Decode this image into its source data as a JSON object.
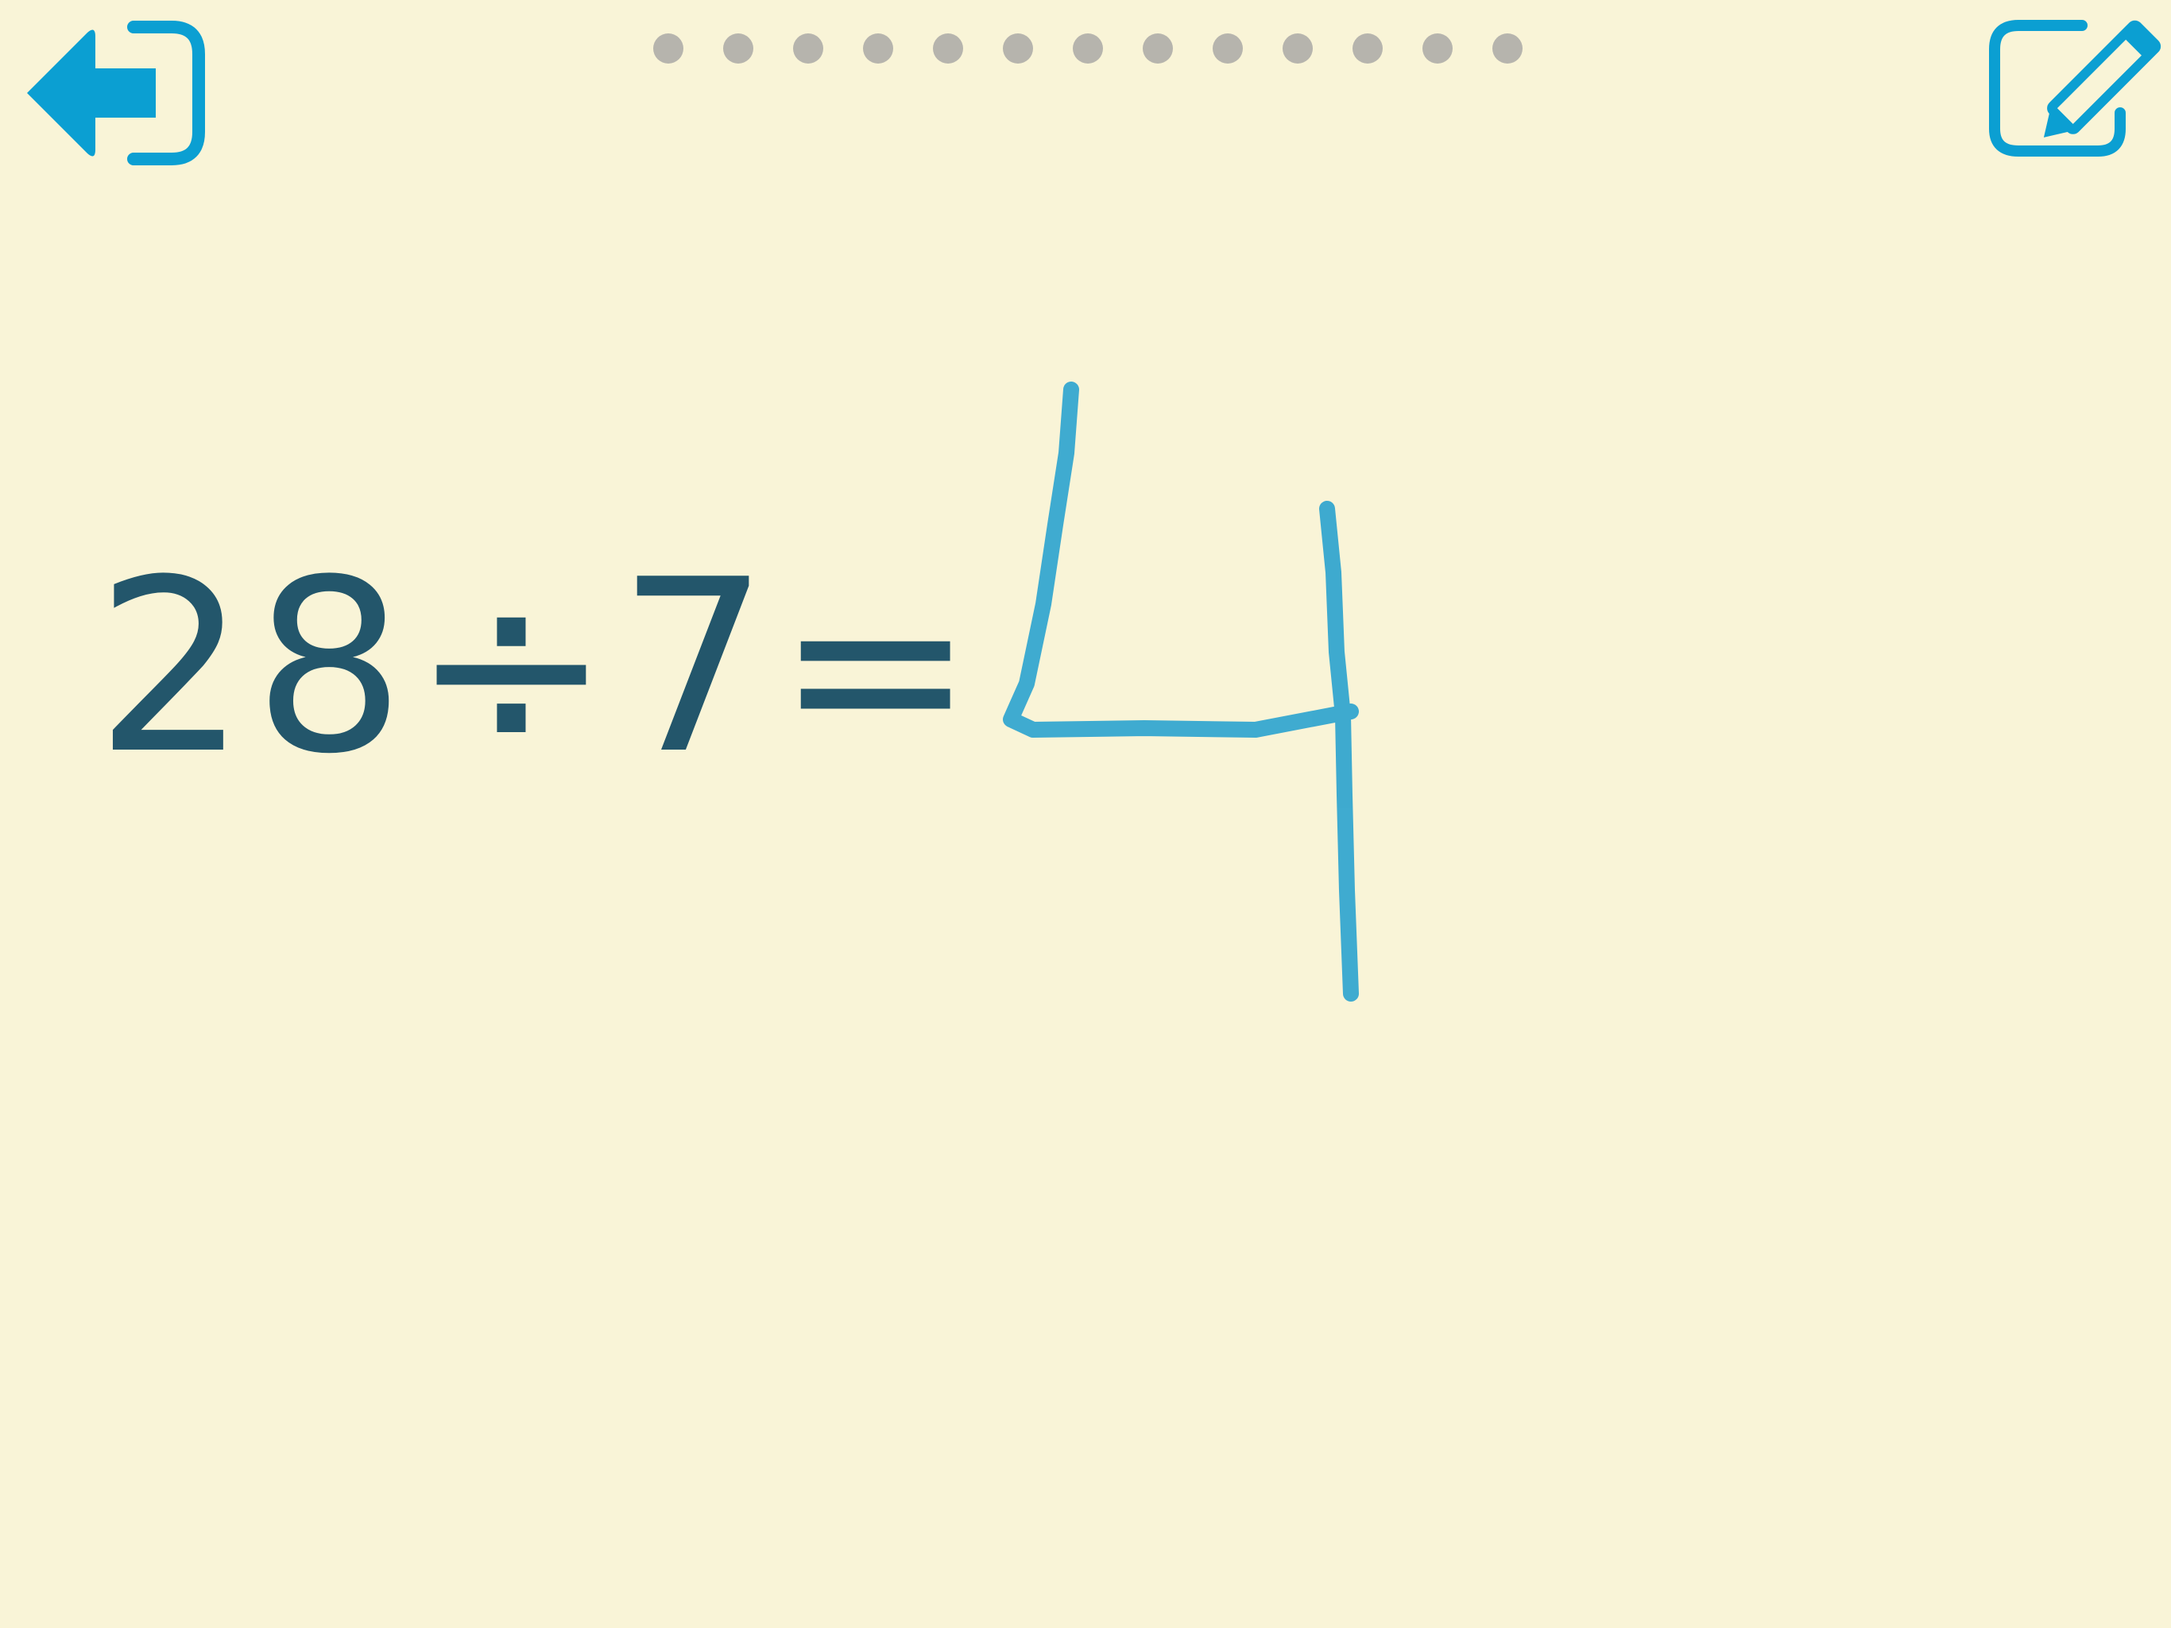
{
  "toolbar": {
    "exit_icon": "exit-arrow-icon",
    "edit_icon": "pencil-edit-icon",
    "accent_color": "#0b9fd2"
  },
  "progress": {
    "total_questions": 13,
    "dot_color": "#b6b4ad"
  },
  "question": {
    "equation": "28÷7="
  },
  "answer": {
    "handwritten_value": "4",
    "ink_color": "#2aa3cf"
  },
  "theme": {
    "background": "#f9f4d7",
    "text_color": "#23566b"
  }
}
